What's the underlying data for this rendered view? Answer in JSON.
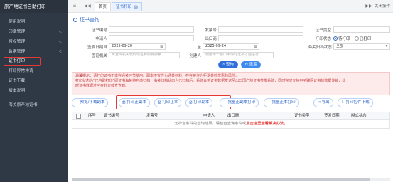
{
  "app": {
    "title": "原产地证书自助打印"
  },
  "sidebar": {
    "items": [
      {
        "label": "使用说明",
        "arrow": ""
      },
      {
        "label": "印章管理",
        "arrow": "<"
      },
      {
        "label": "授权管理",
        "arrow": "<"
      },
      {
        "label": "数据管理",
        "arrow": "<"
      },
      {
        "label": "证书打印",
        "arrow": ""
      },
      {
        "label": "打印异常申请",
        "arrow": ""
      },
      {
        "label": "证书下载",
        "arrow": ""
      },
      {
        "label": "版本说明",
        "arrow": ""
      },
      {
        "label": "海关原产地证书",
        "arrow": ""
      }
    ]
  },
  "topbar": {
    "menu_icon": "≡",
    "back_icon": "◀◀",
    "tabs": [
      {
        "label": "首页"
      },
      {
        "label": "证书打印",
        "close": "×"
      }
    ],
    "forward_icon": "▶▶",
    "close_ops_label": "关闭操作"
  },
  "query": {
    "title": "证书查询",
    "fields": {
      "cert_no": {
        "label": "证书编号",
        "value": ""
      },
      "issue_no": {
        "label": "发票号",
        "value": ""
      },
      "cert_type": {
        "label": "证书类型",
        "value": ""
      },
      "applicant": {
        "label": "申请人",
        "value": ""
      },
      "exporter": {
        "label": "出口商",
        "value": ""
      },
      "print_status": {
        "label": "打印状态",
        "options": [
          "待打印",
          "已打印"
        ],
        "selected": "待打印"
      },
      "sign_date": {
        "label": "签发日期自",
        "value": "2025-09-20"
      },
      "to": {
        "label": "至",
        "value": "2025-09-24"
      },
      "customs_org": {
        "label": "海关归档状态",
        "value": "全部"
      },
      "visa_org": {
        "label": "签证机关",
        "placeholder": "可查询机关代码或名称模糊搜索"
      },
      "creator": {
        "label": "创建人",
        "placeholder": "使用单一窗口申请时证书才能进行"
      }
    },
    "search_label": "查询",
    "reset_label": "重置"
  },
  "notice": {
    "line1_bold": "温馨提示：",
    "line1": "请打印证书正本在通关环节使用。副本不宜作为通关材料，存在被作为拒退关检优惠的风险。",
    "line2": "打印状态为“已自助打印”即证书海关将自动归档，海关归档状态为已归档后。系统会将证书数据发送至出口国产地证书签发系统，同时完成支持电子联网证书的数据传输，此",
    "line3": "时证书数据才可在外方核查查到。"
  },
  "toolbar": {
    "preview_label": "预览/下载副本",
    "print_copy_label": "打印正副本",
    "print_original_label": "打印正本",
    "print_duplicate_label": "打印副本",
    "batch_copy_label": "批量正副本打印",
    "batch_original_label": "批量正本打印",
    "export_label": "导出",
    "print_plugin_label": "打印控件下载"
  },
  "table": {
    "columns": [
      "序号",
      "证书编号",
      "发票号",
      "申请人",
      "出口商",
      "证书类型",
      "签发日期",
      "越式状态"
    ],
    "empty_text": "无符合条件的查询结果，请检查查询条件或",
    "empty_link": "点击这里查看解决办法。"
  }
}
